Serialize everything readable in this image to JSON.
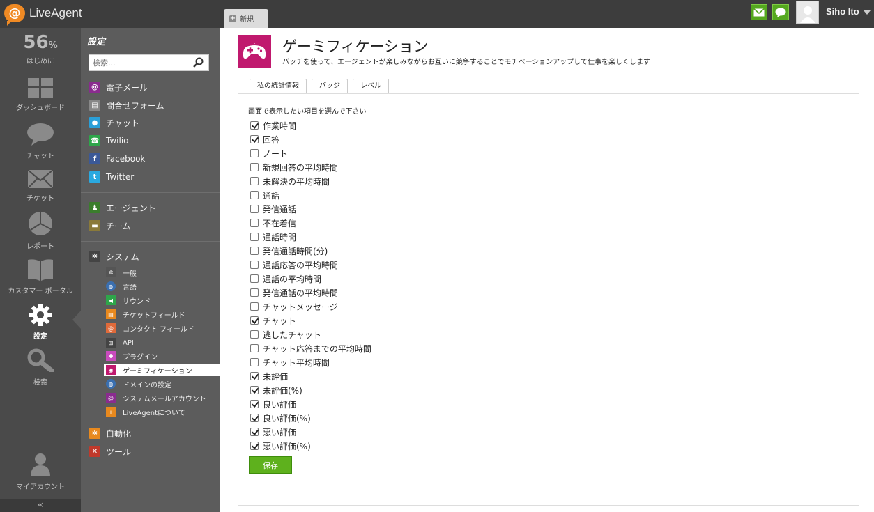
{
  "app": {
    "name": "LiveAgent"
  },
  "topbar": {
    "new_tab_label": "新規",
    "user_name": "Siho Ito"
  },
  "rail": {
    "progress_value": "56",
    "progress_unit": "%",
    "progress_label": "はじめに",
    "items": [
      {
        "label": "ダッシュボード",
        "icon": "dashboard-icon"
      },
      {
        "label": "チャット",
        "icon": "chat-bubble-icon"
      },
      {
        "label": "チケット",
        "icon": "envelope-icon"
      },
      {
        "label": "レポート",
        "icon": "pie-chart-icon"
      },
      {
        "label": "カスタマー ポータル",
        "icon": "book-icon"
      },
      {
        "label": "設定",
        "icon": "gear-icon",
        "active": true
      },
      {
        "label": "検索",
        "icon": "search-icon"
      },
      {
        "label": "マイアカウント",
        "icon": "user-icon"
      }
    ],
    "collapse_glyph": "«"
  },
  "menu": {
    "title": "設定",
    "search_placeholder": "検索...",
    "channels": [
      {
        "label": "電子メール",
        "icon": "at-icon",
        "color": "#8a2b8f"
      },
      {
        "label": "問合せフォーム",
        "icon": "form-icon",
        "color": "#888888"
      },
      {
        "label": "チャット",
        "icon": "chat-icon",
        "color": "#2a9fd8"
      },
      {
        "label": "Twilio",
        "icon": "phone-icon",
        "color": "#2ea64a"
      },
      {
        "label": "Facebook",
        "icon": "facebook-icon",
        "color": "#3b5998"
      },
      {
        "label": "Twitter",
        "icon": "twitter-icon",
        "color": "#2aa9e0"
      }
    ],
    "people": [
      {
        "label": "エージェント",
        "icon": "agents-icon",
        "color": "#3a7d2c"
      },
      {
        "label": "チーム",
        "icon": "folder-icon",
        "color": "#8a7a3a"
      }
    ],
    "system": {
      "label": "システム",
      "icon": "gear-icon"
    },
    "system_items": [
      {
        "label": "一般",
        "icon": "gear-small-icon",
        "color": "#555555"
      },
      {
        "label": "言語",
        "icon": "globe-icon",
        "color": "#3a6fb0"
      },
      {
        "label": "サウンド",
        "icon": "speaker-icon",
        "color": "#2ea64a"
      },
      {
        "label": "チケットフィールド",
        "icon": "ticket-field-icon",
        "color": "#e8891e"
      },
      {
        "label": "コンタクト フィールド",
        "icon": "contact-field-icon",
        "color": "#e06a3a"
      },
      {
        "label": "API",
        "icon": "api-icon",
        "color": "#444444"
      },
      {
        "label": "プラグイン",
        "icon": "puzzle-icon",
        "color": "#c94bbd"
      },
      {
        "label": "ゲーミフィケーション",
        "icon": "gamepad-icon",
        "color": "#c0196e",
        "active": true
      },
      {
        "label": "ドメインの設定",
        "icon": "domain-icon",
        "color": "#3a6fb0"
      },
      {
        "label": "システムメールアカウント",
        "icon": "mail-account-icon",
        "color": "#8a2b8f"
      },
      {
        "label": "LiveAgentについて",
        "icon": "info-icon",
        "color": "#e8891e"
      }
    ],
    "automation": {
      "label": "自動化",
      "icon": "automation-icon",
      "color": "#e8891e"
    },
    "tools": {
      "label": "ツール",
      "icon": "tools-icon",
      "color": "#c0392b"
    }
  },
  "page": {
    "title": "ゲーミフィケーション",
    "subtitle": "バッチを使って、エージェントが楽しみながらお互いに競争することでモチベーションアップして仕事を楽しくします",
    "tabs": [
      "私の統計情報",
      "バッジ",
      "レベル"
    ],
    "prompt": "画面で表示したい項目を選んで下さい",
    "options": [
      {
        "label": "作業時間",
        "checked": true
      },
      {
        "label": "回答",
        "checked": true
      },
      {
        "label": "ノート",
        "checked": false
      },
      {
        "label": "新規回答の平均時間",
        "checked": false
      },
      {
        "label": "未解決の平均時間",
        "checked": false
      },
      {
        "label": "通話",
        "checked": false
      },
      {
        "label": "発信通話",
        "checked": false
      },
      {
        "label": "不在着信",
        "checked": false
      },
      {
        "label": "通話時間",
        "checked": false
      },
      {
        "label": "発信通話時間(分)",
        "checked": false
      },
      {
        "label": "通話応答の平均時間",
        "checked": false
      },
      {
        "label": "通話の平均時間",
        "checked": false
      },
      {
        "label": "発信通話の平均時間",
        "checked": false
      },
      {
        "label": "チャットメッセージ",
        "checked": false
      },
      {
        "label": "チャット",
        "checked": true
      },
      {
        "label": "逃したチャット",
        "checked": false
      },
      {
        "label": "チャット応答までの平均時間",
        "checked": false
      },
      {
        "label": "チャット平均時間",
        "checked": false
      },
      {
        "label": "未評価",
        "checked": true
      },
      {
        "label": "未評価(%)",
        "checked": true
      },
      {
        "label": "良い評価",
        "checked": true
      },
      {
        "label": "良い評価(%)",
        "checked": true
      },
      {
        "label": "悪い評価",
        "checked": true
      },
      {
        "label": "悪い評価(%)",
        "checked": true
      }
    ],
    "save_label": "保存"
  }
}
